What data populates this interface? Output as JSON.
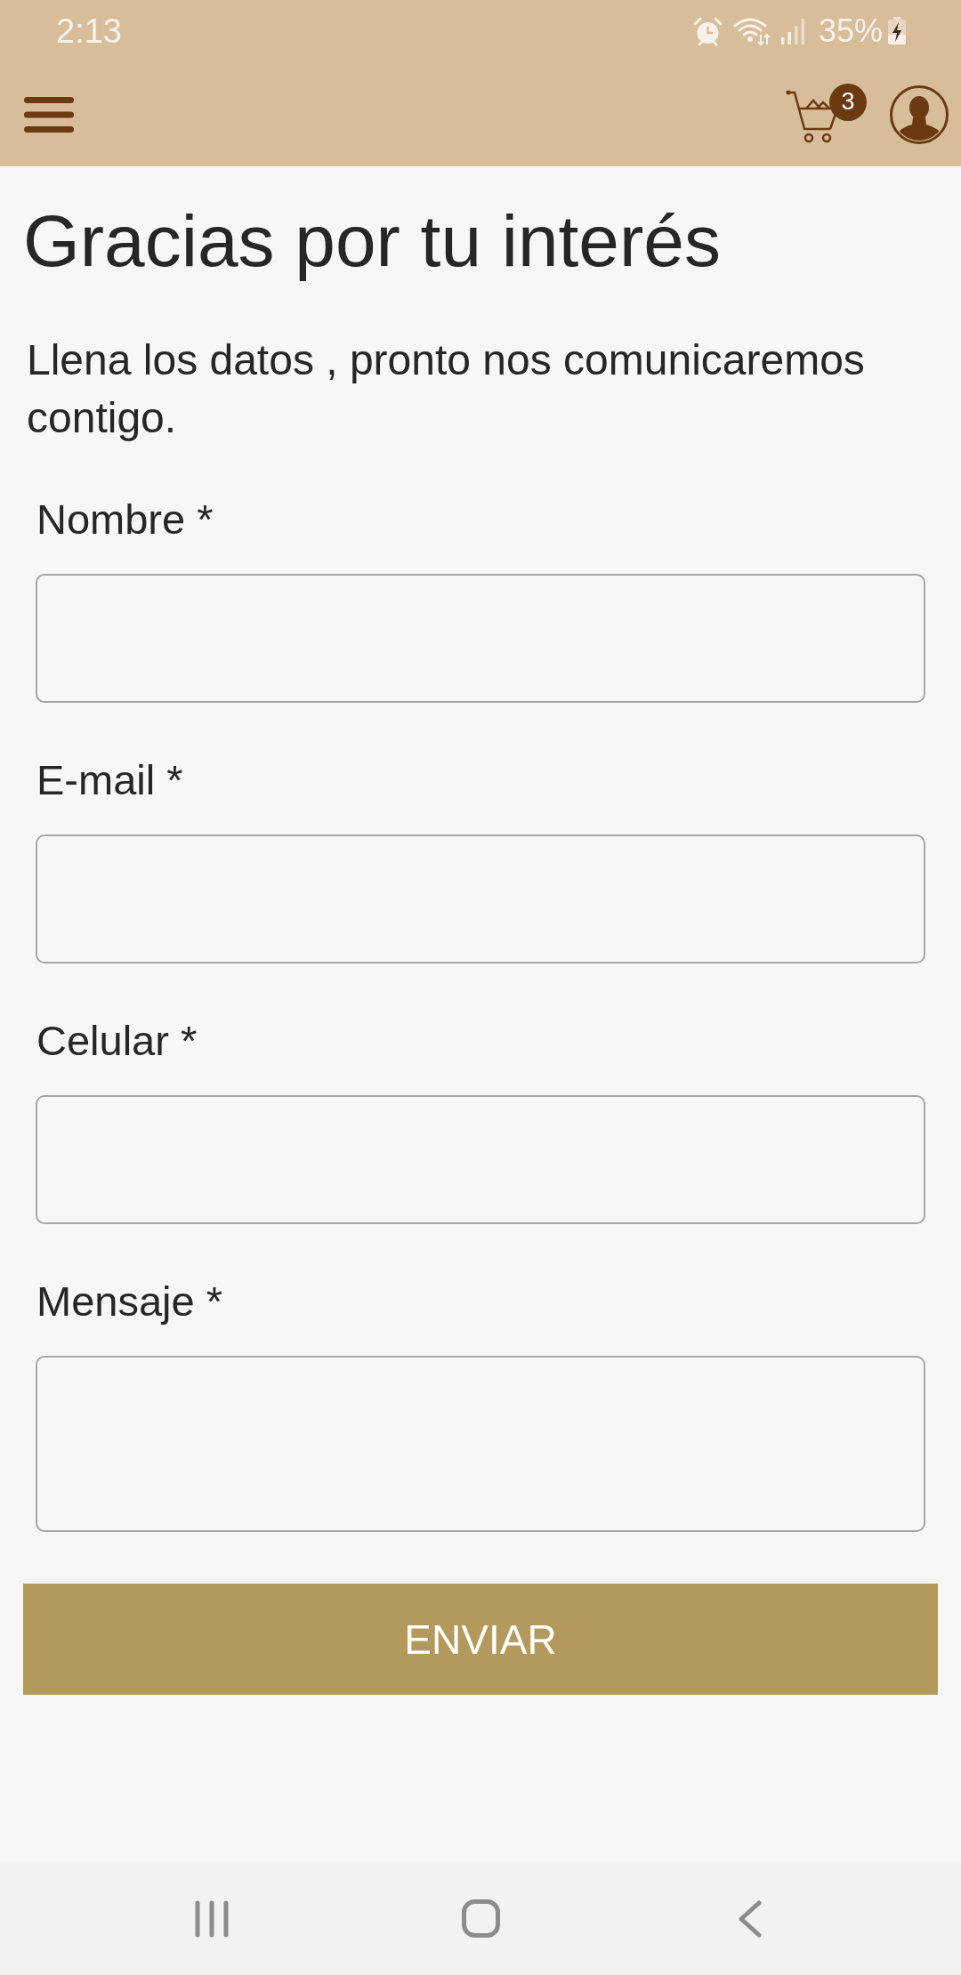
{
  "status_bar": {
    "time": "2:13",
    "battery": "35%"
  },
  "header": {
    "cart_count": "3"
  },
  "page": {
    "title": "Gracias por tu interés",
    "intro": "Llena los datos , pronto nos comunicaremos contigo."
  },
  "form": {
    "fields": [
      {
        "label": "Nombre *",
        "kind": "text"
      },
      {
        "label": "E-mail *",
        "kind": "text"
      },
      {
        "label": "Celular *",
        "kind": "text"
      },
      {
        "label": "Mensaje *",
        "kind": "textarea"
      }
    ],
    "submit": "ENVIAR"
  }
}
